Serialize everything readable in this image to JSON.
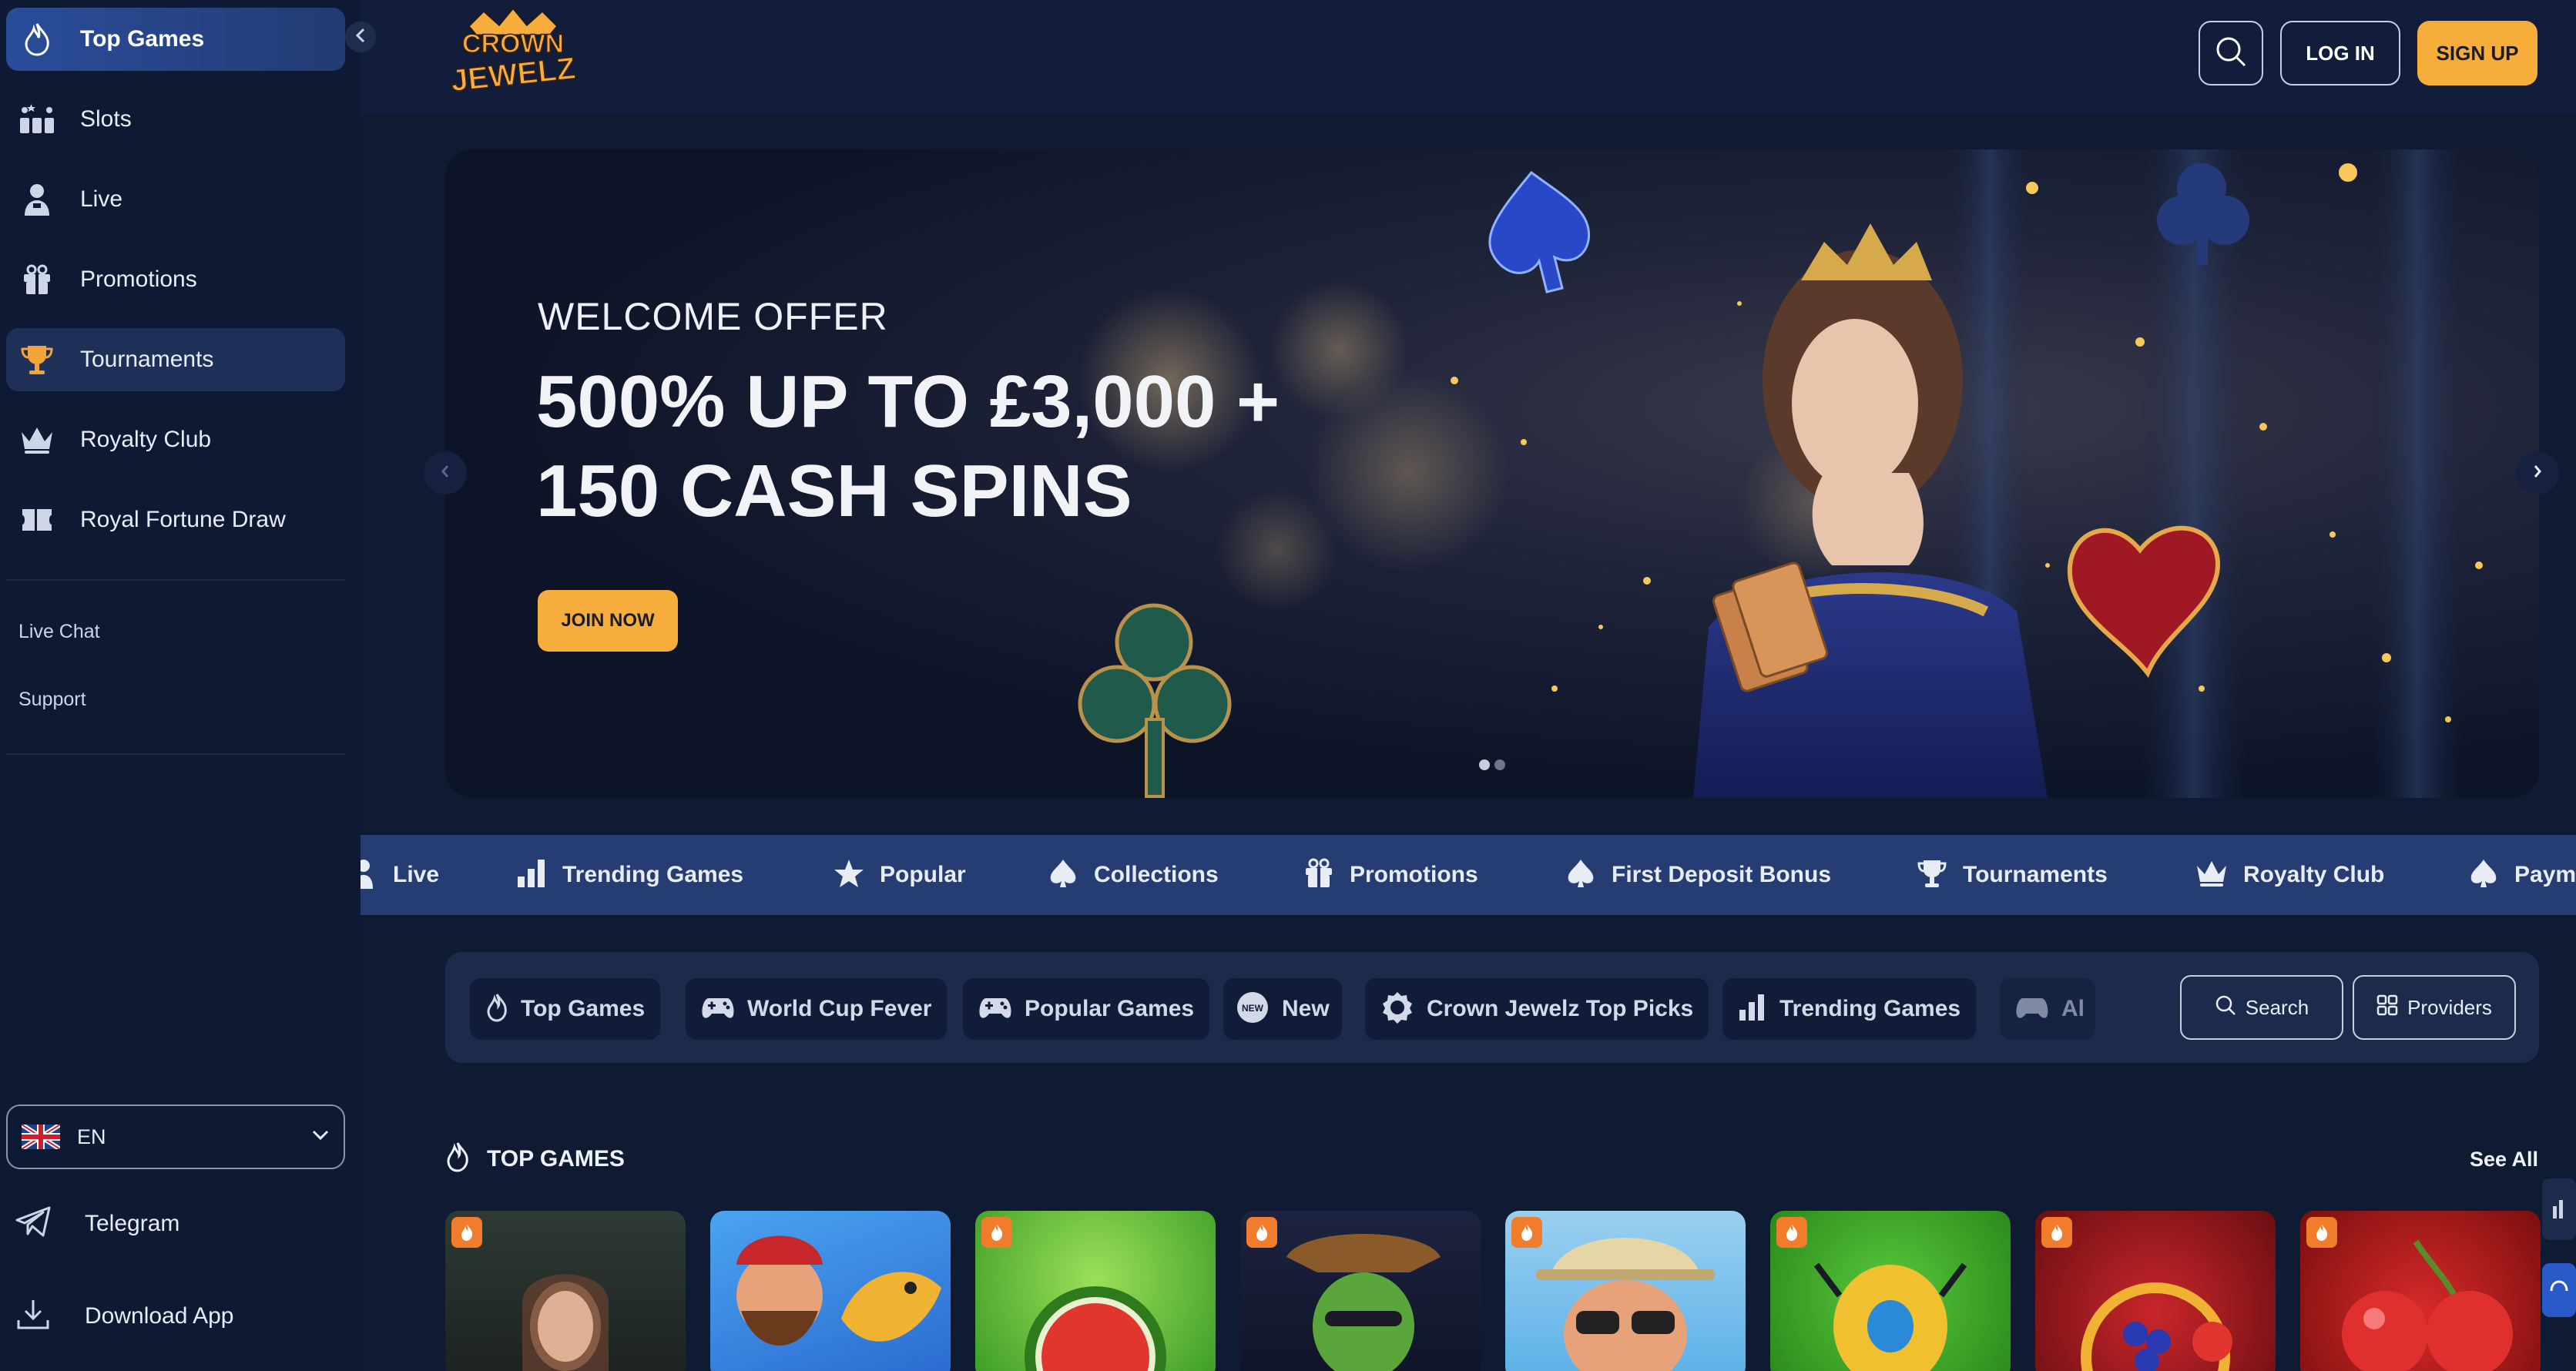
{
  "sidebar": {
    "nav": [
      {
        "label": "Top Games",
        "icon": "flame-icon"
      },
      {
        "label": "Slots",
        "icon": "slots-icon"
      },
      {
        "label": "Live",
        "icon": "live-dealer-icon"
      },
      {
        "label": "Promotions",
        "icon": "gift-icon"
      },
      {
        "label": "Tournaments",
        "icon": "trophy-icon"
      },
      {
        "label": "Royalty Club",
        "icon": "crown-icon"
      },
      {
        "label": "Royal Fortune Draw",
        "icon": "ticket-icon"
      }
    ],
    "links": {
      "live_chat": "Live Chat",
      "support": "Support"
    },
    "language": "EN",
    "telegram": "Telegram",
    "download_app": "Download App"
  },
  "header": {
    "login": "LOG IN",
    "signup": "SIGN UP"
  },
  "hero": {
    "eyebrow": "WELCOME OFFER",
    "headline_line1": "500% UP TO £3,000 +",
    "headline_line2": "150 CASH SPINS",
    "cta": "JOIN NOW"
  },
  "categories": [
    {
      "label": "Live",
      "icon": "live-dealer-icon"
    },
    {
      "label": "Trending Games",
      "icon": "bar-chart-icon"
    },
    {
      "label": "Popular",
      "icon": "star-icon"
    },
    {
      "label": "Collections",
      "icon": "spade-icon"
    },
    {
      "label": "Promotions",
      "icon": "gift-icon"
    },
    {
      "label": "First Deposit Bonus",
      "icon": "spade-icon"
    },
    {
      "label": "Tournaments",
      "icon": "trophy-icon"
    },
    {
      "label": "Royalty Club",
      "icon": "crown-icon"
    },
    {
      "label": "Paym",
      "icon": "spade-icon"
    }
  ],
  "filters": {
    "chips": [
      {
        "label": "Top Games",
        "icon": "flame-icon"
      },
      {
        "label": "World Cup Fever",
        "icon": "gamepad-icon"
      },
      {
        "label": "Popular Games",
        "icon": "gamepad-icon"
      },
      {
        "label": "New",
        "icon": "new-badge-icon"
      },
      {
        "label": "Crown Jewelz Top Picks",
        "icon": "badge-icon"
      },
      {
        "label": "Trending Games",
        "icon": "bar-chart-icon"
      },
      {
        "label": "Al",
        "icon": "gamepad-icon"
      }
    ],
    "search": "Search",
    "providers": "Providers"
  },
  "top_games": {
    "title": "TOP GAMES",
    "see_all": "See All"
  },
  "colors": {
    "accent": "#f6ad3b",
    "nav_active": "#2a4d9a",
    "strip": "#263d74",
    "background": "#0f1a33"
  }
}
